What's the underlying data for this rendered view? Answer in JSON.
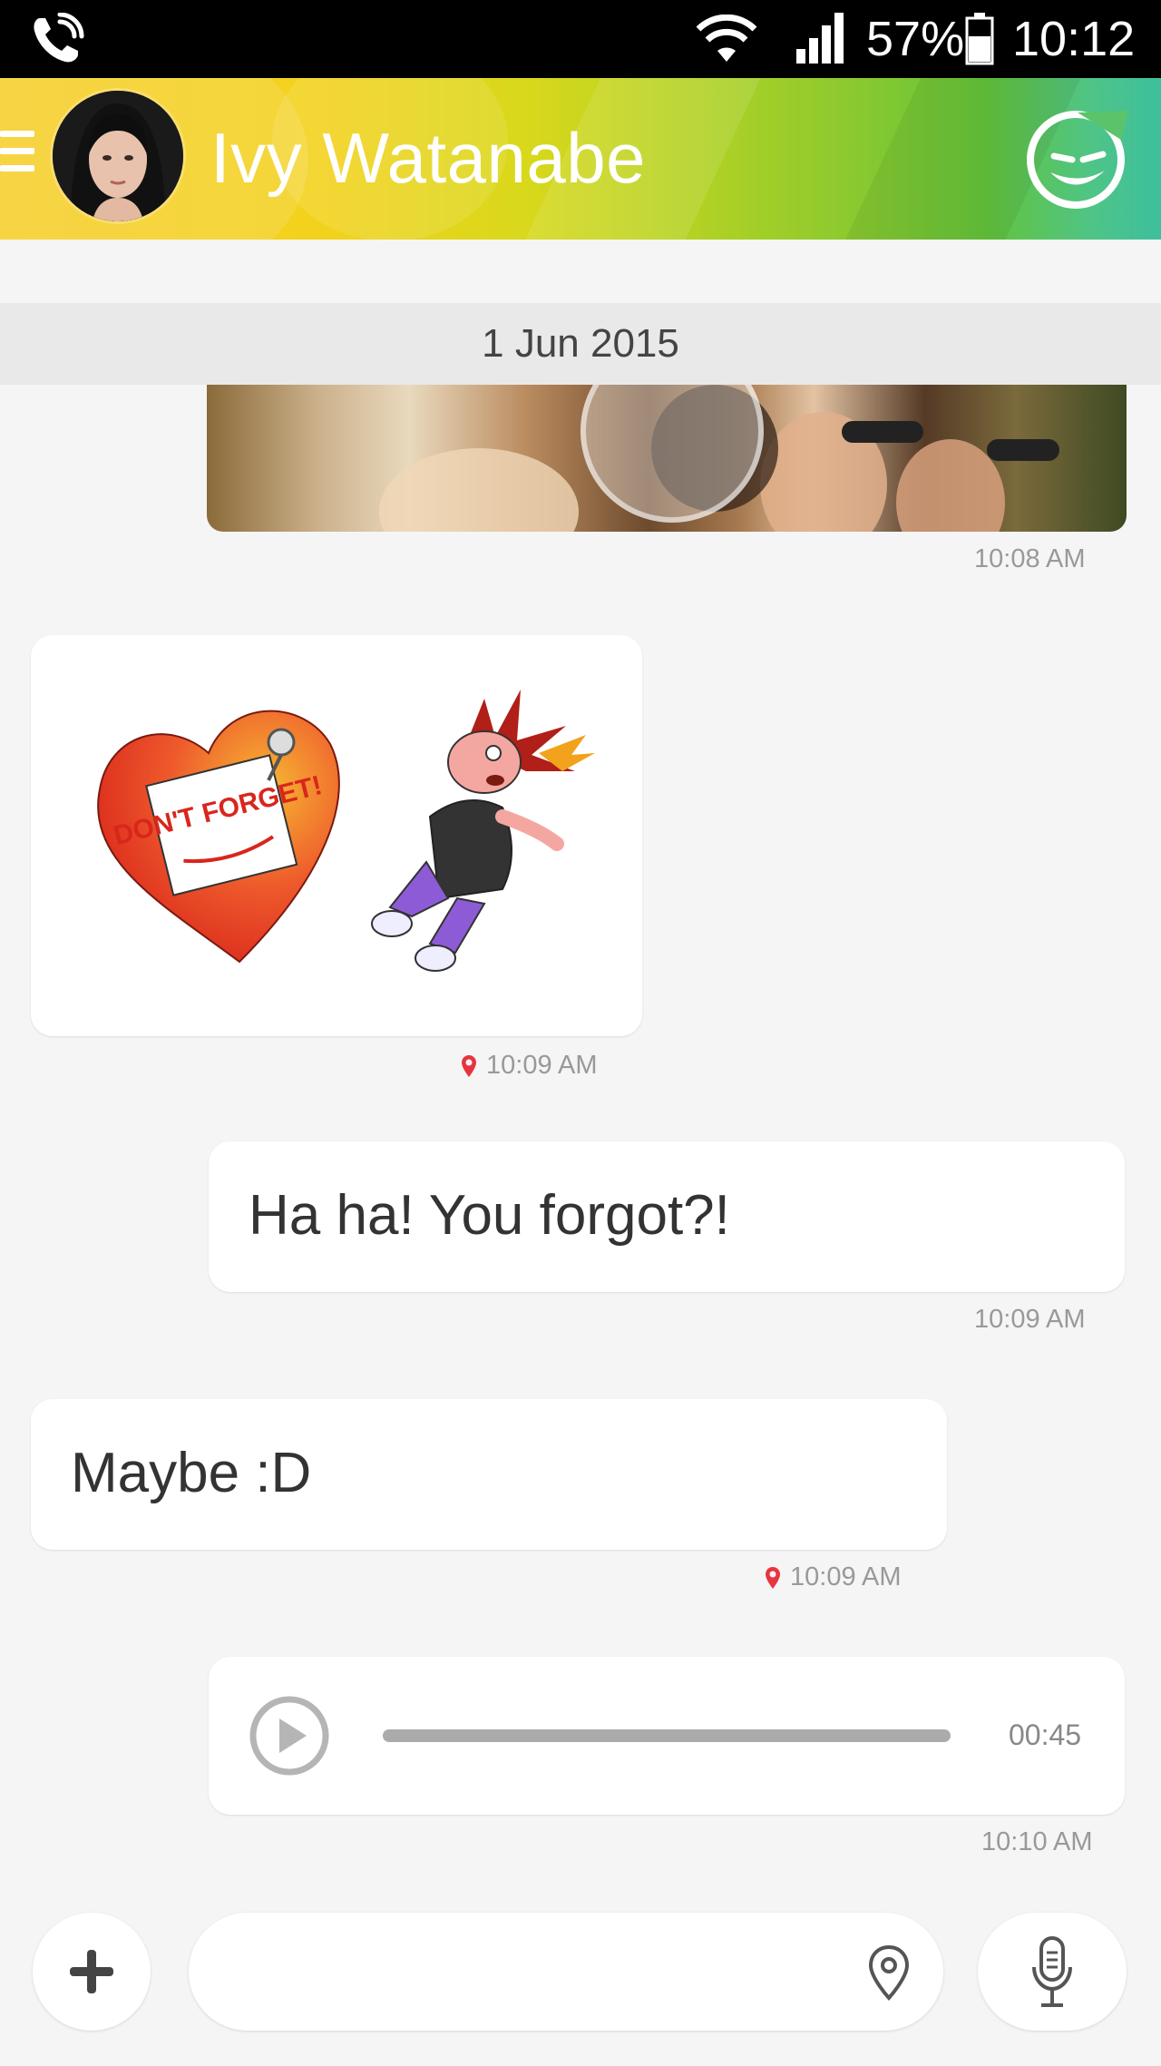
{
  "status_bar": {
    "battery_percent": "57%",
    "time": "10:12",
    "icons": [
      "phone-call-icon",
      "wifi-icon",
      "signal-icon",
      "battery-icon"
    ]
  },
  "header": {
    "contact_name": "Ivy Watanabe",
    "icons": [
      "menu-icon",
      "avatar",
      "sticker-face-icon"
    ]
  },
  "conversation": {
    "date_separator": "1 Jun 2015",
    "messages": [
      {
        "type": "photo",
        "direction": "outgoing",
        "time": "10:08 AM"
      },
      {
        "type": "sticker",
        "direction": "incoming",
        "sticker_text": "DON'T FORGET!",
        "time": "10:09 AM",
        "location": true
      },
      {
        "type": "text",
        "direction": "outgoing",
        "text": "Ha ha! You forgot?!",
        "time": "10:09 AM"
      },
      {
        "type": "text",
        "direction": "incoming",
        "text": "Maybe :D",
        "time": "10:09 AM",
        "location": true
      },
      {
        "type": "audio",
        "direction": "outgoing",
        "duration": "00:45",
        "progress": 0,
        "time": "10:10 AM"
      }
    ]
  },
  "composer": {
    "input_value": "",
    "icons": [
      "plus-icon",
      "location-pin-icon",
      "microphone-icon"
    ]
  },
  "colors": {
    "header_gradient": [
      "#f6ce2a",
      "#b8d322",
      "#63c43a",
      "#3dbf9e"
    ],
    "location_pin": "#e8343f",
    "background": "#f5f5f5"
  }
}
